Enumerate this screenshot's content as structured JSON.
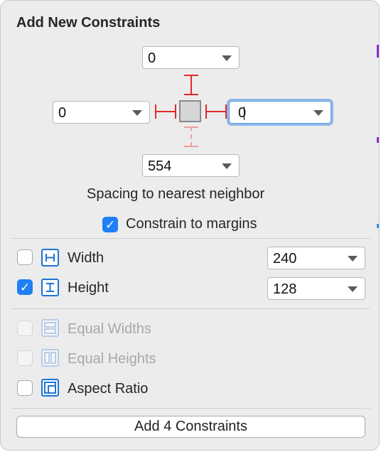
{
  "panel": {
    "title": "Add New Constraints"
  },
  "spacing": {
    "top_value": "0",
    "left_value": "0",
    "right_value": "0",
    "bottom_value": "554",
    "caption": "Spacing to nearest neighbor",
    "margins_label": "Constrain to margins",
    "margins_checked": true
  },
  "size": {
    "width_label": "Width",
    "width_value": "240",
    "width_checked": false,
    "height_label": "Height",
    "height_value": "128",
    "height_checked": true
  },
  "relations": {
    "equal_widths_label": "Equal Widths",
    "equal_heights_label": "Equal Heights",
    "aspect_ratio_label": "Aspect Ratio"
  },
  "footer": {
    "add_button_label": "Add 4 Constraints"
  },
  "colors": {
    "accent": "#1f7ff5",
    "constraint_red": "#e02a2a",
    "focus_ring": "#8db8ea"
  }
}
